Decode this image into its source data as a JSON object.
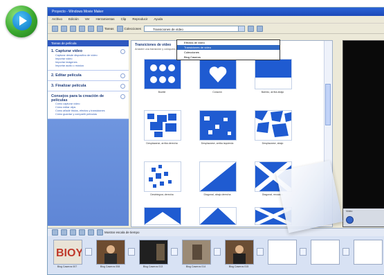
{
  "window": {
    "title": "Proyecto - Windows Movie Maker"
  },
  "menu": [
    "Archivo",
    "Edición",
    "Ver",
    "Herramientas",
    "Clip",
    "Reproducir",
    "Ayuda"
  ],
  "toolbar": {
    "tasks_label": "Tareas",
    "collections_label": "Colecciones",
    "combo_value": "Transiciones de vídeo"
  },
  "dropdown": {
    "items": [
      "Efectos de vídeo",
      "Transiciones de vídeo",
      "Colecciones",
      "Blog Caseros"
    ],
    "selected_index": 1
  },
  "taskpane": {
    "header": "Tareas de película",
    "sections": [
      {
        "title": "1. Capturar vídeo",
        "links": [
          "Capturar desde dispositivo de vídeo",
          "Importar vídeo",
          "Importar imágenes",
          "Importar audio o música"
        ]
      },
      {
        "title": "2. Editar película",
        "links": []
      },
      {
        "title": "3. Finalizar película",
        "links": []
      },
      {
        "title": "Consejos para la creación de películas",
        "links": [
          "Cómo capturar vídeo",
          "Cómo editar clips",
          "Cómo añadir títulos, efectos y transiciones",
          "Cómo guardar y compartir películas"
        ]
      }
    ]
  },
  "content": {
    "header": "Transiciones de vídeo",
    "subheader": "Arrastre una transición y colóquela entre dos clips en el guión gráfico",
    "transitions": [
      {
        "caption": "Bowtie"
      },
      {
        "caption": "Corazón"
      },
      {
        "caption": "Barrido, arriba abajo"
      },
      {
        "caption": "Desplazarse, arriba derecha"
      },
      {
        "caption": "Desplazarse, arriba izquierda"
      },
      {
        "caption": "Desplazarse, abajo"
      },
      {
        "caption": "Desintegrar, derecha"
      },
      {
        "caption": "Diagonal, abajo derecha"
      },
      {
        "caption": "Diagonal, recuadro"
      }
    ]
  },
  "preview": {
    "caption": "Vídeo"
  },
  "storyboard": {
    "toolbar_label": "Mostrar escala de tiempo",
    "clips": [
      "Blog Caseros 007",
      "Blog Caseros 008",
      "Blog Caseros 013",
      "Blog Caseros 014",
      "Blog Caseros 015"
    ]
  },
  "colors": {
    "accent": "#1f5bd1",
    "taskpane": "#6e93dd",
    "selection": "#316ac5"
  }
}
